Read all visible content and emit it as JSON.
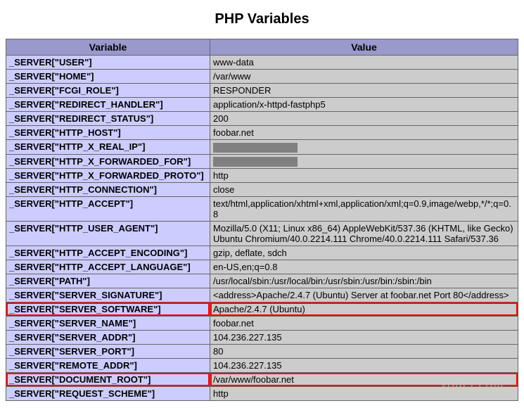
{
  "title": "PHP Variables",
  "headers": {
    "variable": "Variable",
    "value": "Value"
  },
  "watermark": "youcl.com",
  "rows": [
    {
      "variable": "_SERVER[\"USER\"]",
      "value": "www-data"
    },
    {
      "variable": "_SERVER[\"HOME\"]",
      "value": "/var/www"
    },
    {
      "variable": "_SERVER[\"FCGI_ROLE\"]",
      "value": "RESPONDER"
    },
    {
      "variable": "_SERVER[\"REDIRECT_HANDLER\"]",
      "value": "application/x-httpd-fastphp5"
    },
    {
      "variable": "_SERVER[\"REDIRECT_STATUS\"]",
      "value": "200"
    },
    {
      "variable": "_SERVER[\"HTTP_HOST\"]",
      "value": "foobar.net"
    },
    {
      "variable": "_SERVER[\"HTTP_X_REAL_IP\"]",
      "value": "",
      "redacted": true
    },
    {
      "variable": "_SERVER[\"HTTP_X_FORWARDED_FOR\"]",
      "value": "",
      "redacted": true
    },
    {
      "variable": "_SERVER[\"HTTP_X_FORWARDED_PROTO\"]",
      "value": "http"
    },
    {
      "variable": "_SERVER[\"HTTP_CONNECTION\"]",
      "value": "close"
    },
    {
      "variable": "_SERVER[\"HTTP_ACCEPT\"]",
      "value": "text/html,application/xhtml+xml,application/xml;q=0.9,image/webp,*/*;q=0.8"
    },
    {
      "variable": "_SERVER[\"HTTP_USER_AGENT\"]",
      "value": "Mozilla/5.0 (X11; Linux x86_64) AppleWebKit/537.36 (KHTML, like Gecko) Ubuntu Chromium/40.0.2214.111 Chrome/40.0.2214.111 Safari/537.36"
    },
    {
      "variable": "_SERVER[\"HTTP_ACCEPT_ENCODING\"]",
      "value": "gzip, deflate, sdch"
    },
    {
      "variable": "_SERVER[\"HTTP_ACCEPT_LANGUAGE\"]",
      "value": "en-US,en;q=0.8"
    },
    {
      "variable": "_SERVER[\"PATH\"]",
      "value": "/usr/local/sbin:/usr/local/bin:/usr/sbin:/usr/bin:/sbin:/bin"
    },
    {
      "variable": "_SERVER[\"SERVER_SIGNATURE\"]",
      "value": "<address>Apache/2.4.7 (Ubuntu) Server at foobar.net Port 80</address>"
    },
    {
      "variable": "_SERVER[\"SERVER_SOFTWARE\"]",
      "value": "Apache/2.4.7 (Ubuntu)",
      "highlight": true
    },
    {
      "variable": "_SERVER[\"SERVER_NAME\"]",
      "value": "foobar.net"
    },
    {
      "variable": "_SERVER[\"SERVER_ADDR\"]",
      "value": "104.236.227.135"
    },
    {
      "variable": "_SERVER[\"SERVER_PORT\"]",
      "value": "80"
    },
    {
      "variable": "_SERVER[\"REMOTE_ADDR\"]",
      "value": "104.236.227.135"
    },
    {
      "variable": "_SERVER[\"DOCUMENT_ROOT\"]",
      "value": "/var/www/foobar.net",
      "highlight": true
    },
    {
      "variable": "_SERVER[\"REQUEST_SCHEME\"]",
      "value": "http"
    }
  ]
}
